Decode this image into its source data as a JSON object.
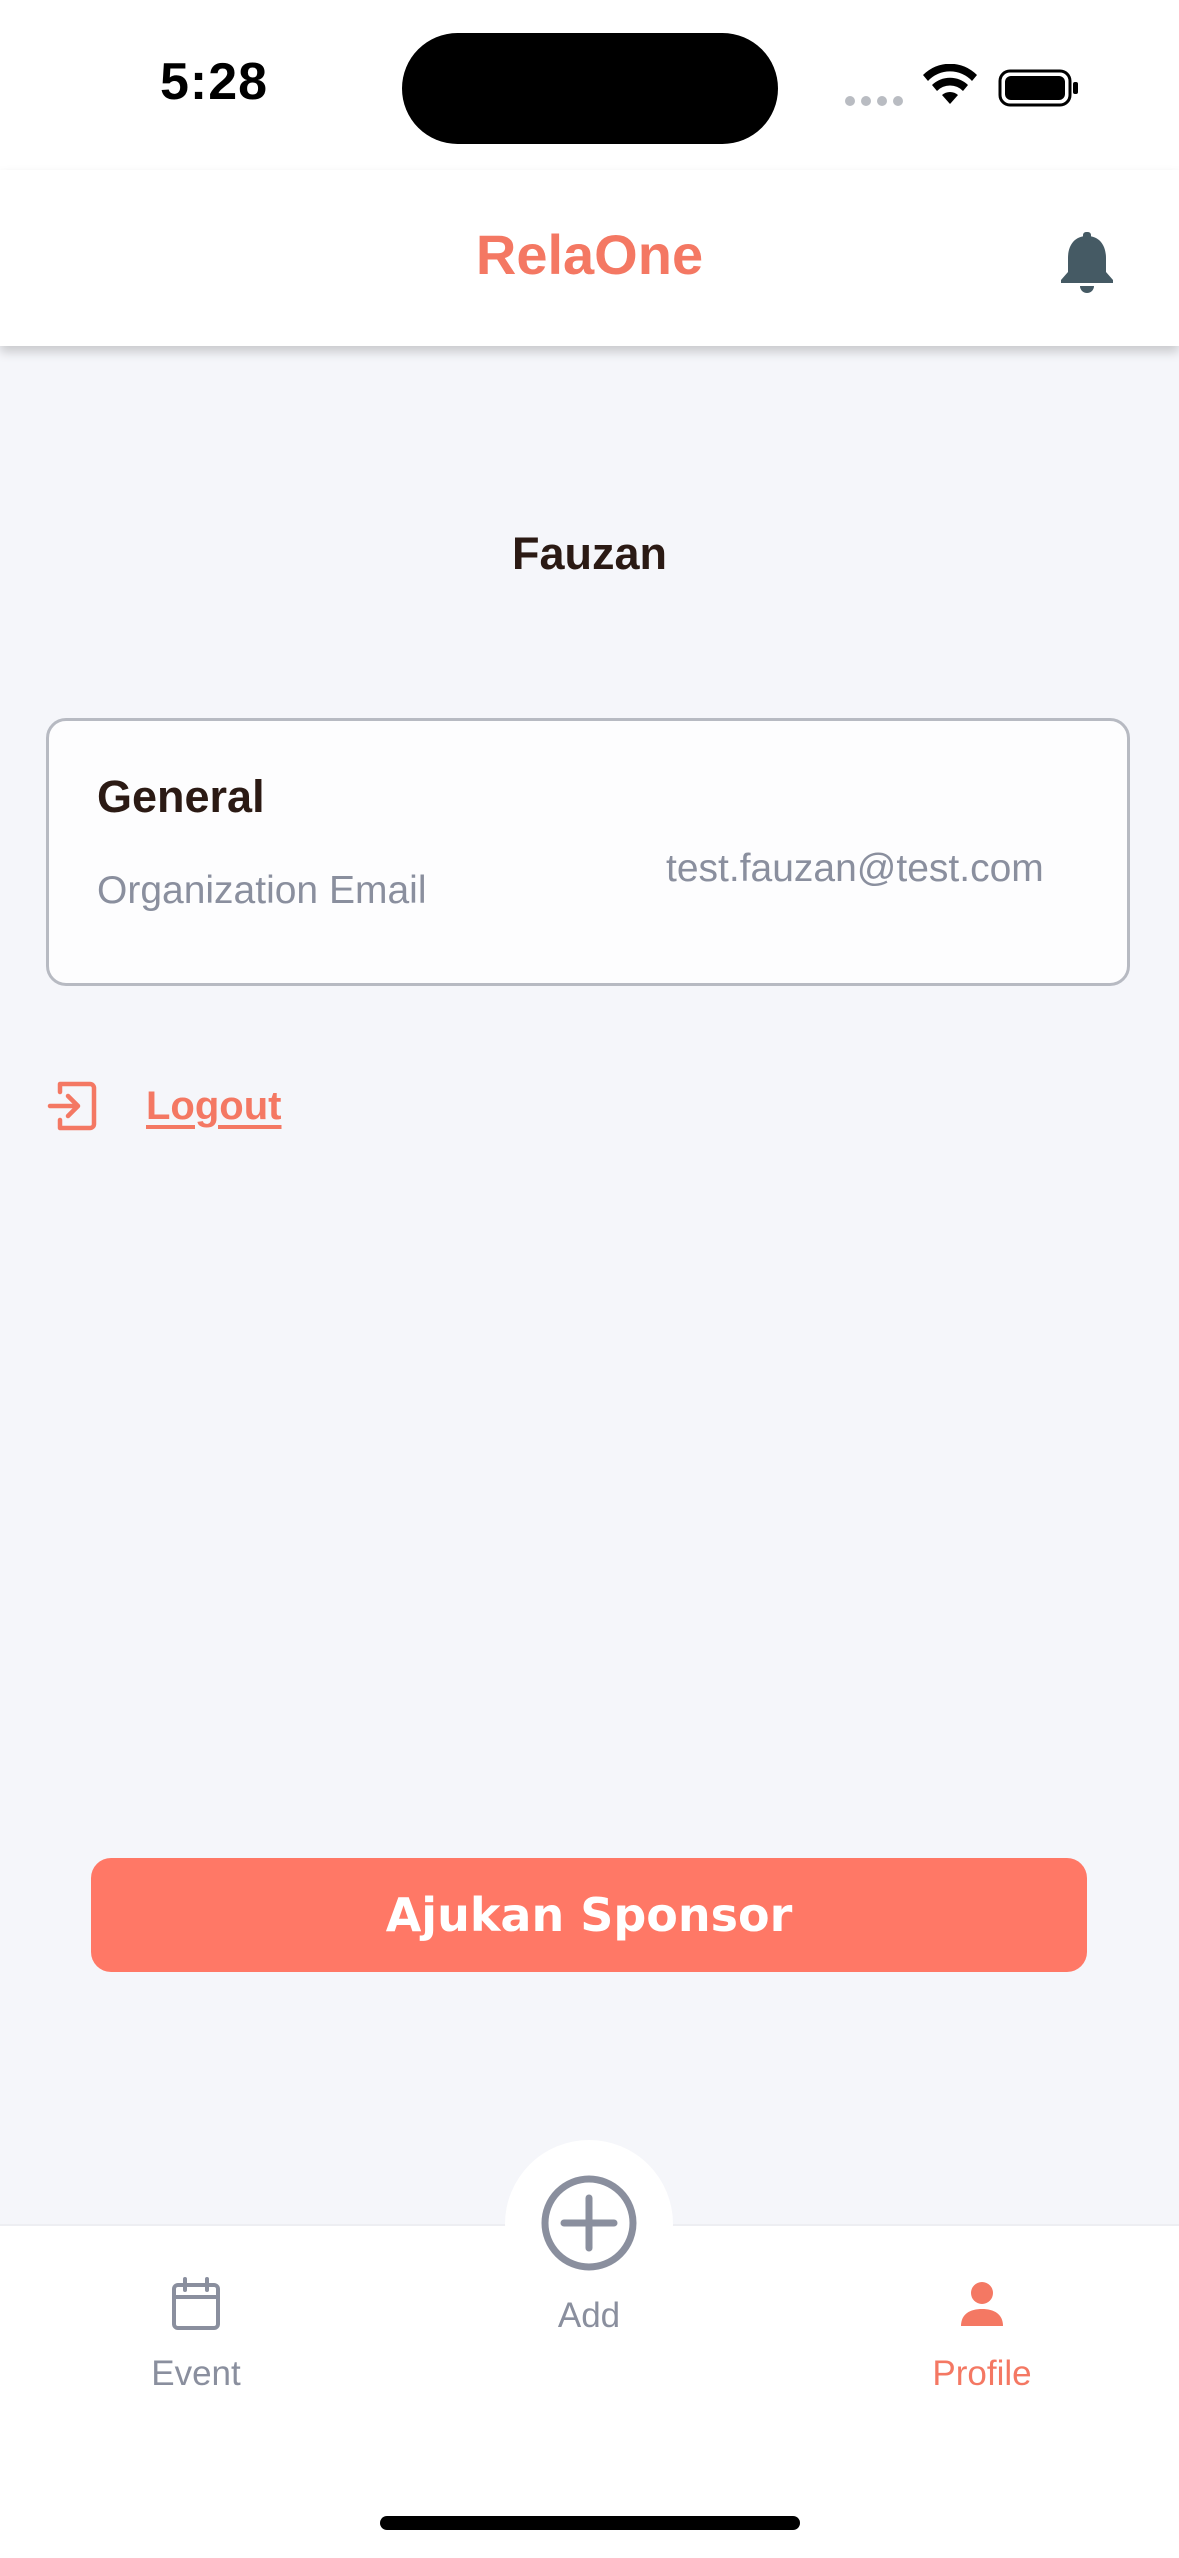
{
  "status_bar": {
    "time": "5:28"
  },
  "header": {
    "title": "RelaOne",
    "bell_icon": "bell-icon"
  },
  "profile": {
    "name": "Fauzan",
    "general": {
      "title": "General",
      "email_label": "Organization Email",
      "email_value": "test.fauzan@test.com"
    },
    "logout_label": "Logout",
    "logout_icon": "logout-icon"
  },
  "sponsor_button": {
    "label": "Ajukan Sponsor"
  },
  "bottom_nav": {
    "event_label": "Event",
    "add_label": "Add",
    "profile_label": "Profile",
    "active": "Profile"
  },
  "colors": {
    "brand": "#F47863",
    "button": "#FF7866",
    "background": "#F5F6FA",
    "muted_text": "#8A8F9E",
    "dark_text": "#2B1A14"
  }
}
